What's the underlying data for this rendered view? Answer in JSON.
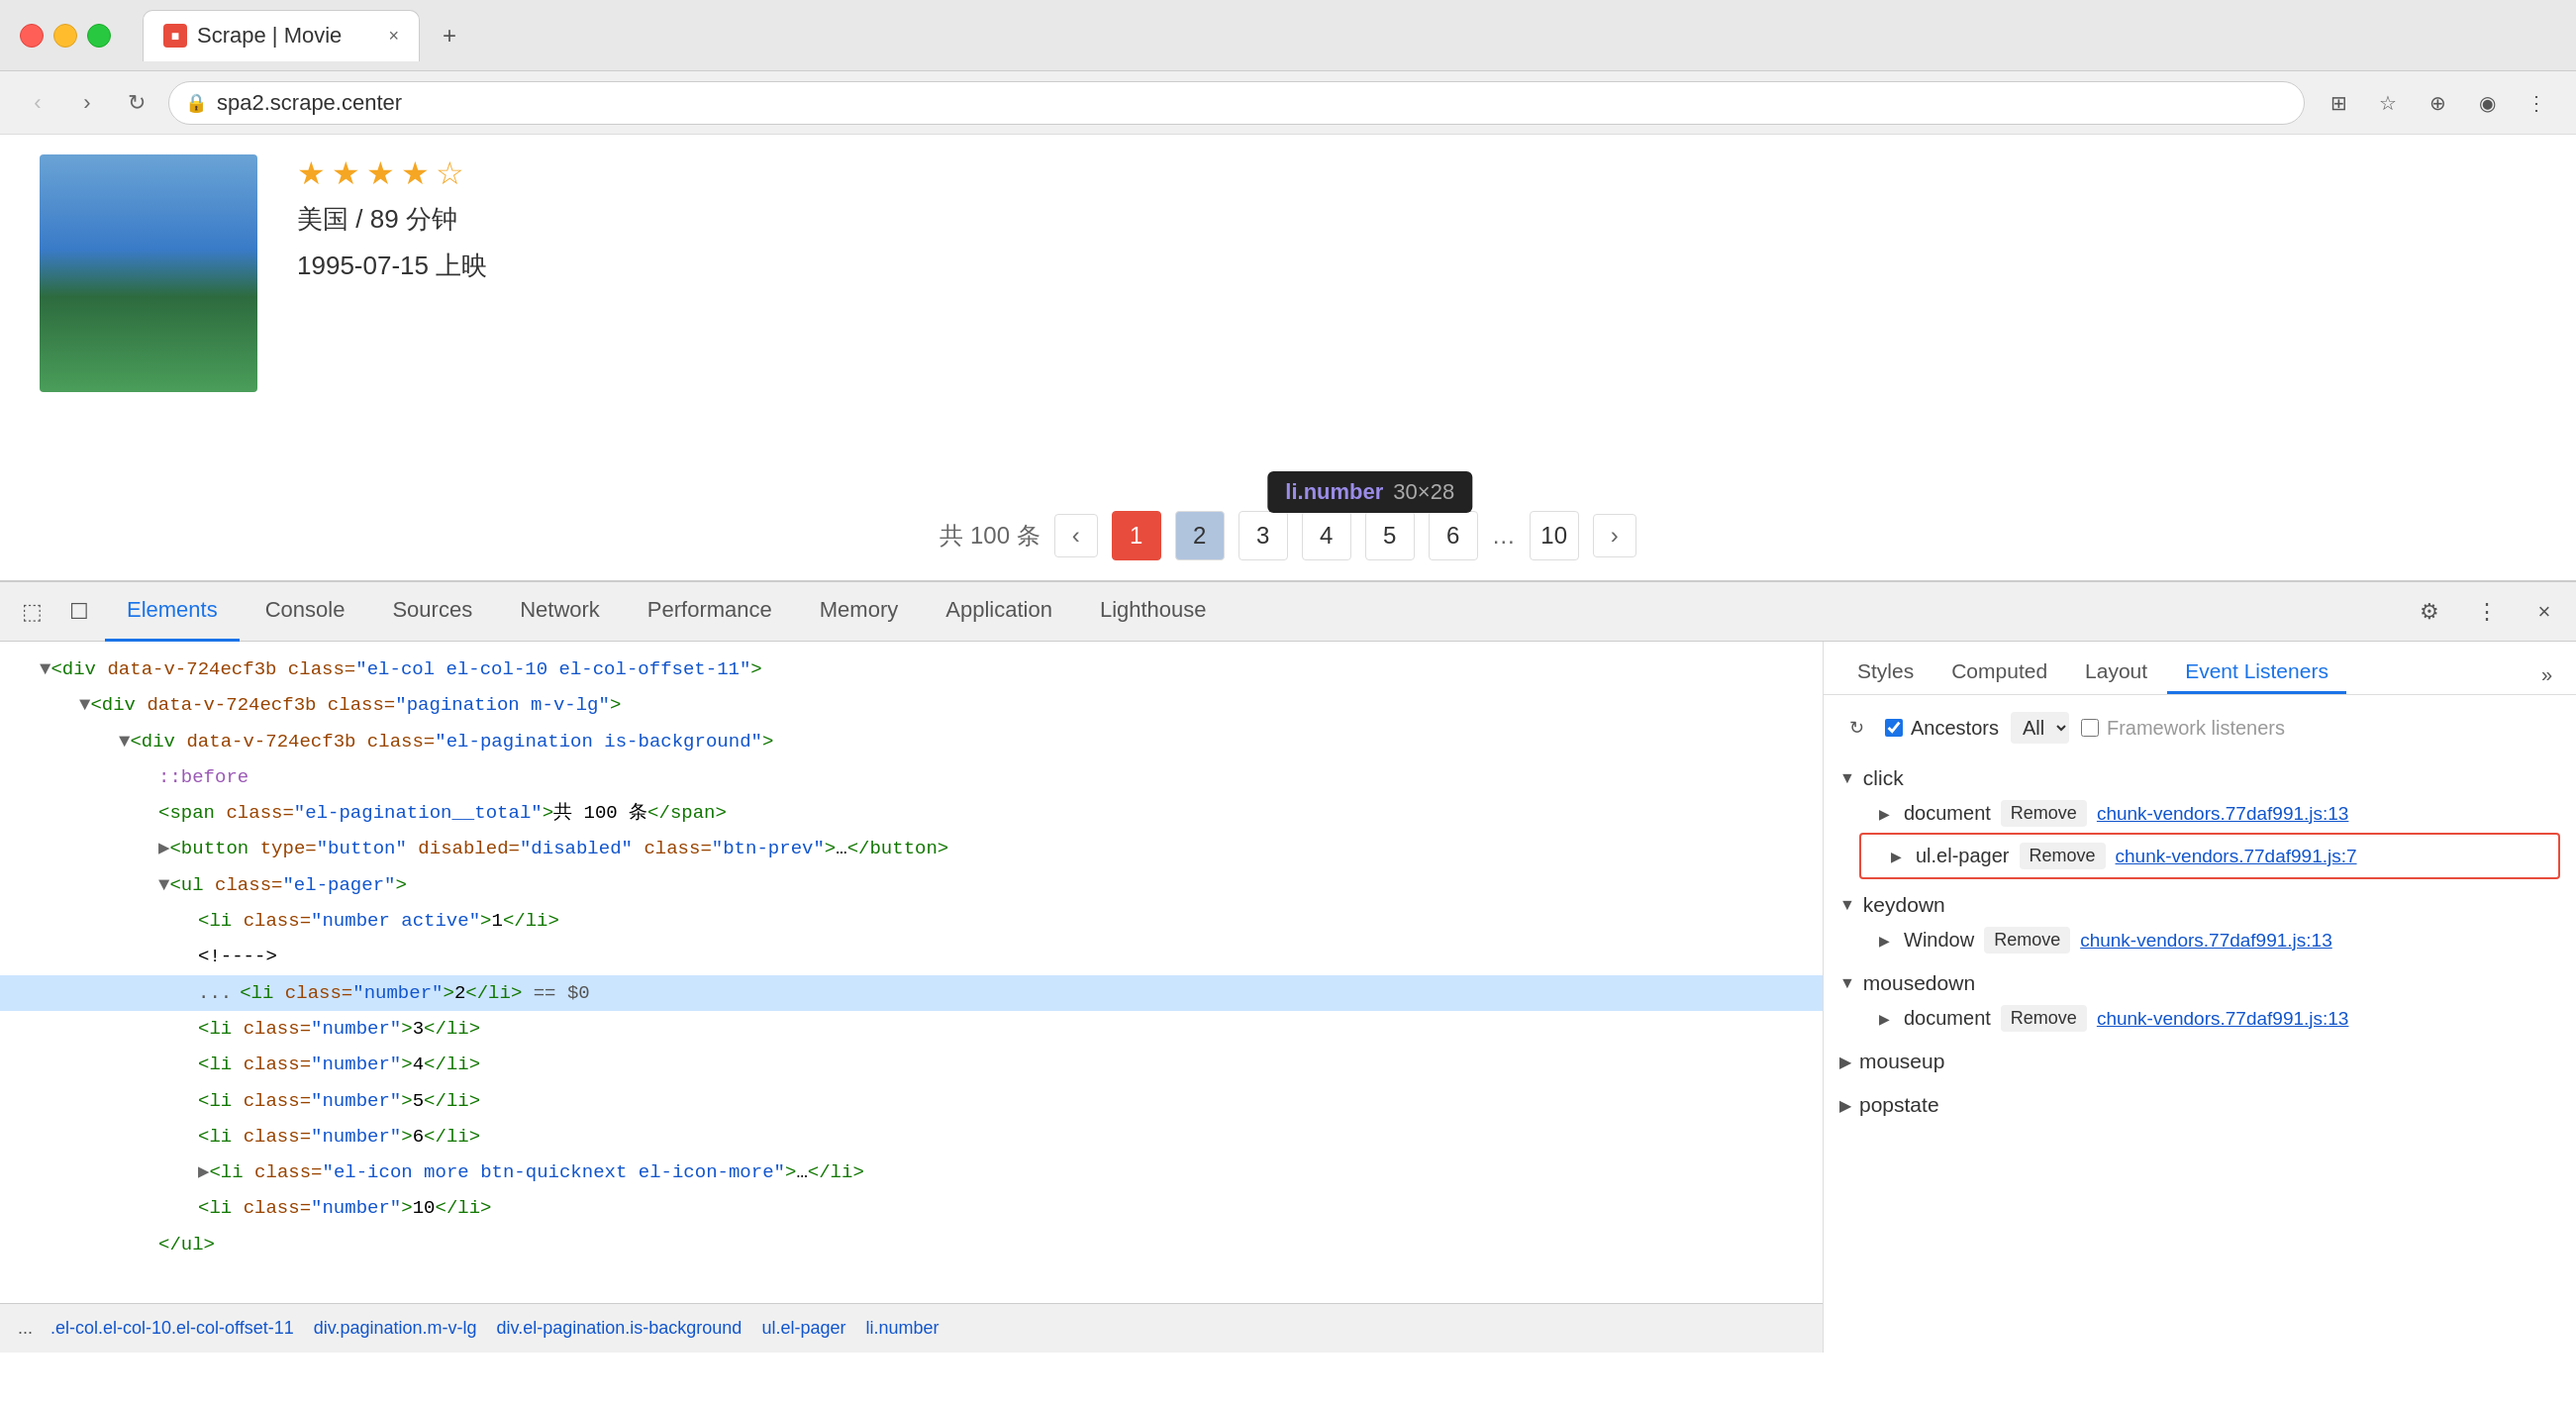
{
  "browser": {
    "traffic_lights": [
      "red",
      "yellow",
      "green"
    ],
    "tab": {
      "favicon": "■",
      "title": "Scrape | Movie",
      "close_icon": "×"
    },
    "new_tab_icon": "+",
    "address": {
      "url": "spa2.scrape.center",
      "lock_icon": "🔒"
    },
    "nav": {
      "back": "‹",
      "forward": "›",
      "reload": "↻"
    }
  },
  "movie": {
    "meta": "美国 / 89 分钟",
    "date": "1995-07-15 上映",
    "stars": [
      "★",
      "★",
      "★",
      "★",
      "☆"
    ]
  },
  "pagination": {
    "total": "共 100 条",
    "prev_icon": "‹",
    "next_icon": "›",
    "pages": [
      "1",
      "2",
      "3",
      "4",
      "5",
      "6",
      "…",
      "10"
    ],
    "tooltip": {
      "class": "li.number",
      "size": "30×28"
    }
  },
  "devtools": {
    "tabs": [
      "Elements",
      "Console",
      "Sources",
      "Network",
      "Performance",
      "Memory",
      "Application",
      "Lighthouse"
    ],
    "active_tab": "Elements",
    "icons": {
      "inspect": "⬚",
      "device": "☐",
      "gear": "⚙",
      "more": "⋮",
      "close": "×"
    },
    "elements": {
      "lines": [
        {
          "indent": 1,
          "content": "▼<div data-v-724ecf3b class=\"el-col el-col-10 el-col-offset-11\">"
        },
        {
          "indent": 2,
          "content": "▼<div data-v-724ecf3b class=\"pagination m-v-lg\">"
        },
        {
          "indent": 3,
          "content": "▼<div data-v-724ecf3b class=\"el-pagination is-background\">"
        },
        {
          "indent": 4,
          "content": "::before"
        },
        {
          "indent": 4,
          "content": "<span class=\"el-pagination__total\">共 100 条</span>"
        },
        {
          "indent": 4,
          "content": "▶<button type=\"button\" disabled=\"disabled\" class=\"btn-prev\">…</button>"
        },
        {
          "indent": 4,
          "content": "▼<ul class=\"el-pager\">"
        },
        {
          "indent": 5,
          "content": "<li class=\"number active\">1</li>"
        },
        {
          "indent": 5,
          "content": "<!---->"
        },
        {
          "indent": 5,
          "content": "<li class=\"number\">2</li>  == $0",
          "selected": true
        },
        {
          "indent": 5,
          "content": "<li class=\"number\">3</li>"
        },
        {
          "indent": 5,
          "content": "<li class=\"number\">4</li>"
        },
        {
          "indent": 5,
          "content": "<li class=\"number\">5</li>"
        },
        {
          "indent": 5,
          "content": "<li class=\"number\">6</li>"
        },
        {
          "indent": 5,
          "content": "▶<li class=\"el-icon more btn-quicknext el-icon-more\">…</li>"
        },
        {
          "indent": 5,
          "content": "<li class=\"number\">10</li>"
        },
        {
          "indent": 4,
          "content": "</ul>"
        }
      ]
    },
    "breadcrumb": [
      ".el-col.el-col-10.el-col-offset-11",
      "div.pagination.m-v-lg",
      "div.el-pagination.is-background",
      "ul.el-pager",
      "li.number"
    ]
  },
  "right_panel": {
    "tabs": [
      "Styles",
      "Computed",
      "Layout",
      "Event Listeners"
    ],
    "active_tab": "Event Listeners",
    "more_icon": "»",
    "event_listeners": {
      "header": {
        "refresh_icon": "↻",
        "ancestors_label": "Ancestors",
        "ancestors_checked": true,
        "ancestors_options": [
          "All"
        ],
        "ancestors_selected": "All",
        "framework_label": "Framework listeners",
        "framework_checked": false
      },
      "sections": [
        {
          "type": "click",
          "listeners": [
            {
              "target": "document",
              "remove_label": "Remove",
              "file": "chunk-vendors.77daf991.js:13",
              "highlighted": false
            },
            {
              "target": "ul.el-pager",
              "remove_label": "Remove",
              "file": "chunk-vendors.77daf991.js:7",
              "highlighted": true
            }
          ]
        },
        {
          "type": "keydown",
          "listeners": [
            {
              "target": "Window",
              "remove_label": "Remove",
              "file": "chunk-vendors.77daf991.js:13",
              "highlighted": false
            }
          ]
        },
        {
          "type": "mousedown",
          "listeners": [
            {
              "target": "document",
              "remove_label": "Remove",
              "file": "chunk-vendors.77daf991.js:13",
              "highlighted": false
            }
          ]
        },
        {
          "type": "mouseup",
          "listeners": []
        },
        {
          "type": "popstate",
          "listeners": []
        }
      ]
    }
  }
}
